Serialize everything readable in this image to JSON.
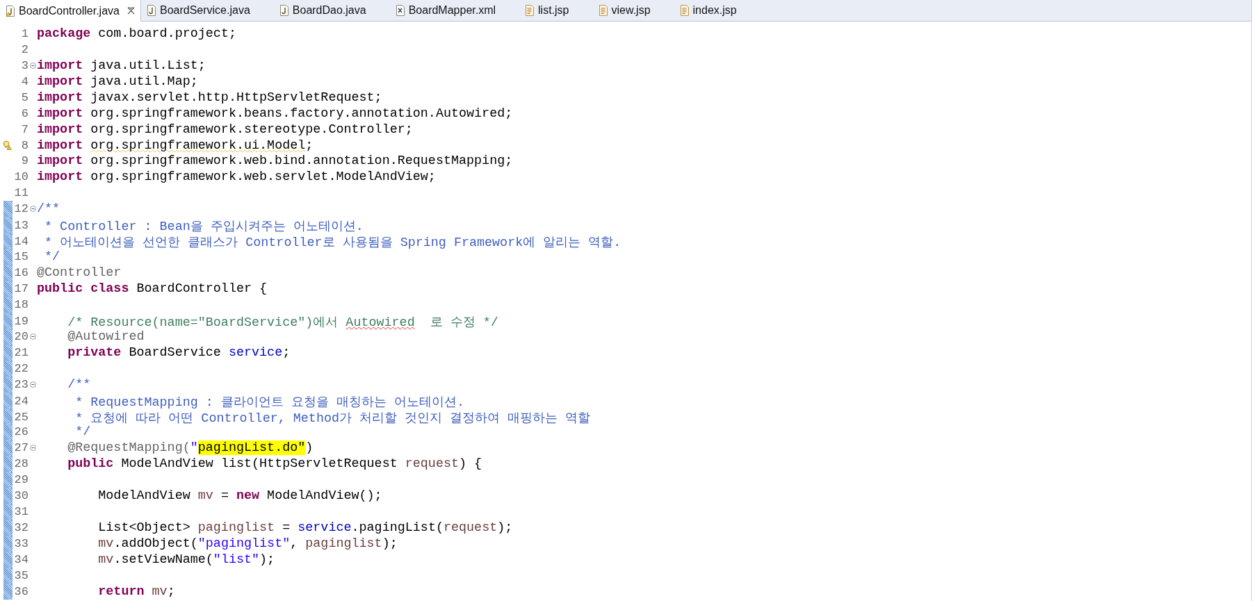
{
  "tabs": [
    {
      "label": "BoardController.java",
      "kind": "java",
      "selected": true,
      "warning": true
    },
    {
      "label": "BoardService.java",
      "kind": "java",
      "selected": false,
      "warning": false
    },
    {
      "label": "BoardDao.java",
      "kind": "java",
      "selected": false,
      "warning": false
    },
    {
      "label": "BoardMapper.xml",
      "kind": "xml",
      "selected": false,
      "warning": false
    },
    {
      "label": "list.jsp",
      "kind": "jsp",
      "selected": false,
      "warning": false
    },
    {
      "label": "view.jsp",
      "kind": "jsp",
      "selected": false,
      "warning": false
    },
    {
      "label": "index.jsp",
      "kind": "jsp",
      "selected": false,
      "warning": false
    }
  ],
  "lines": [
    {
      "number": "1",
      "fold": false,
      "changed": false,
      "tokens": [
        {
          "kind": "keyword",
          "text": "package"
        },
        {
          "kind": "plain",
          "text": " com.board.project;"
        }
      ]
    },
    {
      "number": "2",
      "fold": false,
      "changed": false
    },
    {
      "number": "3",
      "fold": true,
      "changed": false,
      "tokens": [
        {
          "kind": "keyword",
          "text": "import"
        },
        {
          "kind": "plain",
          "text": " java.util.List;"
        }
      ]
    },
    {
      "number": "4",
      "fold": false,
      "changed": false,
      "tokens": [
        {
          "kind": "keyword",
          "text": "import"
        },
        {
          "kind": "plain",
          "text": " java.util.Map;"
        }
      ]
    },
    {
      "number": "5",
      "fold": false,
      "changed": false,
      "tokens": [
        {
          "kind": "keyword",
          "text": "import"
        },
        {
          "kind": "plain",
          "text": " javax.servlet.http.HttpServletRequest;"
        }
      ]
    },
    {
      "number": "6",
      "fold": false,
      "changed": false,
      "tokens": [
        {
          "kind": "keyword",
          "text": "import"
        },
        {
          "kind": "plain",
          "text": " org.springframework.beans.factory.annotation.Autowired;"
        }
      ]
    },
    {
      "number": "7",
      "fold": false,
      "changed": false,
      "tokens": [
        {
          "kind": "keyword",
          "text": "import"
        },
        {
          "kind": "plain",
          "text": " org.springframework.stereotype.Controller;"
        }
      ]
    },
    {
      "number": "8",
      "fold": false,
      "changed": false,
      "warning": true,
      "tokens": [
        {
          "kind": "keyword",
          "text": "import "
        },
        {
          "kind": "plain",
          "text": "org.springframework.ui.Model",
          "warning_underline": true
        },
        {
          "kind": "plain",
          "text": ";"
        }
      ]
    },
    {
      "number": "9",
      "fold": false,
      "changed": false,
      "tokens": [
        {
          "kind": "keyword",
          "text": "import"
        },
        {
          "kind": "plain",
          "text": " org.springframework.web.bind.annotation.RequestMapping;"
        }
      ]
    },
    {
      "number": "10",
      "fold": false,
      "changed": false,
      "tokens": [
        {
          "kind": "keyword",
          "text": "import"
        },
        {
          "kind": "plain",
          "text": " org.springframework.web.servlet.ModelAndView;"
        }
      ]
    },
    {
      "number": "11",
      "fold": false,
      "changed": false
    },
    {
      "number": "12",
      "fold": true,
      "changed": true,
      "tokens": [
        {
          "kind": "doc",
          "text": "/**"
        }
      ]
    },
    {
      "number": "13",
      "fold": false,
      "changed": true,
      "tokens": [
        {
          "kind": "doc",
          "text": " * Controller : Bean을 주입시켜주는 어노테이션."
        }
      ]
    },
    {
      "number": "14",
      "fold": false,
      "changed": true,
      "tokens": [
        {
          "kind": "doc",
          "text": " * 어노테이션을 선언한 클래스가 Controller로 사용됨을 Spring Framework에 알리는 역할."
        }
      ]
    },
    {
      "number": "15",
      "fold": false,
      "changed": true,
      "tokens": [
        {
          "kind": "doc",
          "text": " */"
        }
      ]
    },
    {
      "number": "16",
      "fold": false,
      "changed": true,
      "tokens": [
        {
          "kind": "annotation",
          "text": "@Controller"
        }
      ]
    },
    {
      "number": "17",
      "fold": false,
      "changed": true,
      "tokens": [
        {
          "kind": "keyword",
          "text": "public class"
        },
        {
          "kind": "plain",
          "text": " BoardController {"
        }
      ]
    },
    {
      "number": "18",
      "fold": false,
      "changed": true
    },
    {
      "number": "19",
      "fold": false,
      "changed": true,
      "tokens": [
        {
          "kind": "comment",
          "text": "    /* Resource(name=\"BoardService\")에서 "
        },
        {
          "kind": "comment",
          "text": "Autowired",
          "misspelled": true
        },
        {
          "kind": "comment",
          "text": "  로 수정 */"
        }
      ]
    },
    {
      "number": "20",
      "fold": true,
      "changed": true,
      "tokens": [
        {
          "kind": "annotation",
          "text": "    @Autowired"
        }
      ]
    },
    {
      "number": "21",
      "fold": false,
      "changed": true,
      "tokens": [
        {
          "kind": "keyword",
          "text": "    private"
        },
        {
          "kind": "plain",
          "text": " BoardService "
        },
        {
          "kind": "field",
          "text": "service"
        },
        {
          "kind": "plain",
          "text": ";"
        }
      ]
    },
    {
      "number": "22",
      "fold": false,
      "changed": true
    },
    {
      "number": "23",
      "fold": true,
      "changed": true,
      "tokens": [
        {
          "kind": "doc",
          "text": "    /**"
        }
      ]
    },
    {
      "number": "24",
      "fold": false,
      "changed": true,
      "tokens": [
        {
          "kind": "doc",
          "text": "     * RequestMapping : 클라이언트 요청을 매칭하는 어노테이션."
        }
      ]
    },
    {
      "number": "25",
      "fold": false,
      "changed": true,
      "tokens": [
        {
          "kind": "doc",
          "text": "     * 요청에 따라 어떤 Controller, Method가 처리할 것인지 결정하여 매핑하는 역할"
        }
      ]
    },
    {
      "number": "26",
      "fold": false,
      "changed": true,
      "tokens": [
        {
          "kind": "doc",
          "text": "     */"
        }
      ]
    },
    {
      "number": "27",
      "fold": true,
      "changed": true,
      "tokens": [
        {
          "kind": "annotation",
          "text": "    @RequestMapping("
        },
        {
          "kind": "string",
          "text": "\""
        },
        {
          "kind": "string",
          "text": "pagingList.do\"",
          "highlighted": true
        },
        {
          "kind": "plain",
          "text": ")"
        }
      ]
    },
    {
      "number": "28",
      "fold": false,
      "changed": true,
      "tokens": [
        {
          "kind": "keyword",
          "text": "    public"
        },
        {
          "kind": "plain",
          "text": " ModelAndView list(HttpServletRequest "
        },
        {
          "kind": "local",
          "text": "request"
        },
        {
          "kind": "plain",
          "text": ") {"
        }
      ]
    },
    {
      "number": "29",
      "fold": false,
      "changed": true
    },
    {
      "number": "30",
      "fold": false,
      "changed": true,
      "tokens": [
        {
          "kind": "plain",
          "text": "        ModelAndView "
        },
        {
          "kind": "local",
          "text": "mv"
        },
        {
          "kind": "plain",
          "text": " = "
        },
        {
          "kind": "keyword",
          "text": "new"
        },
        {
          "kind": "plain",
          "text": " ModelAndView();"
        }
      ]
    },
    {
      "number": "31",
      "fold": false,
      "changed": true
    },
    {
      "number": "32",
      "fold": false,
      "changed": true,
      "tokens": [
        {
          "kind": "plain",
          "text": "        List<Object> "
        },
        {
          "kind": "local",
          "text": "paginglist"
        },
        {
          "kind": "plain",
          "text": " = "
        },
        {
          "kind": "field",
          "text": "service"
        },
        {
          "kind": "plain",
          "text": ".pagingList("
        },
        {
          "kind": "local",
          "text": "request"
        },
        {
          "kind": "plain",
          "text": ");"
        }
      ]
    },
    {
      "number": "33",
      "fold": false,
      "changed": true,
      "tokens": [
        {
          "kind": "local",
          "text": "        mv"
        },
        {
          "kind": "plain",
          "text": ".addObject("
        },
        {
          "kind": "string",
          "text": "\"paginglist\""
        },
        {
          "kind": "plain",
          "text": ", "
        },
        {
          "kind": "local",
          "text": "paginglist"
        },
        {
          "kind": "plain",
          "text": ");"
        }
      ]
    },
    {
      "number": "34",
      "fold": false,
      "changed": true,
      "tokens": [
        {
          "kind": "local",
          "text": "        mv"
        },
        {
          "kind": "plain",
          "text": ".setViewName("
        },
        {
          "kind": "string",
          "text": "\"list\""
        },
        {
          "kind": "plain",
          "text": ");"
        }
      ]
    },
    {
      "number": "35",
      "fold": false,
      "changed": true
    },
    {
      "number": "36",
      "fold": false,
      "changed": true,
      "tokens": [
        {
          "kind": "keyword",
          "text": "        return "
        },
        {
          "kind": "local",
          "text": "mv"
        },
        {
          "kind": "plain",
          "text": ";"
        }
      ]
    }
  ]
}
